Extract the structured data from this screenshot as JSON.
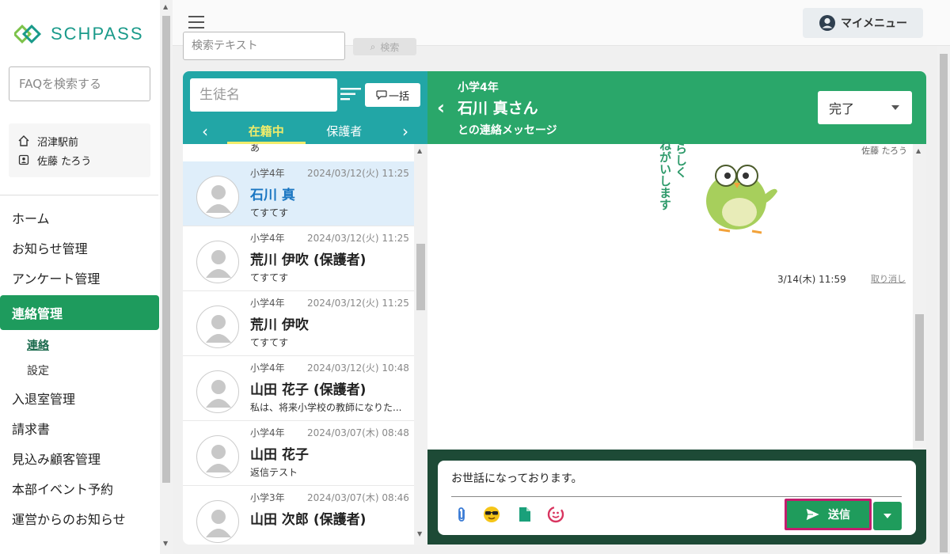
{
  "brand": {
    "name": "SCHPASS",
    "color": "#1a9a8a"
  },
  "sidebar": {
    "faq_placeholder": "FAQを検索する",
    "school": "沼津駅前",
    "user": "佐藤 たろう",
    "nav": [
      {
        "label": "ホーム"
      },
      {
        "label": "お知らせ管理"
      },
      {
        "label": "アンケート管理"
      },
      {
        "label": "連絡管理",
        "active": true
      },
      {
        "label": "連絡",
        "sub": true,
        "selected": true
      },
      {
        "label": "設定",
        "sub": true
      },
      {
        "label": "入退室管理"
      },
      {
        "label": "請求書"
      },
      {
        "label": "見込み顧客管理"
      },
      {
        "label": "本部イベント予約"
      },
      {
        "label": "運営からのお知らせ"
      }
    ]
  },
  "topbar": {
    "mymenu_label": "マイメニュー"
  },
  "search_strip": {
    "placeholder": "検索テキスト",
    "button_label": "検索"
  },
  "list": {
    "student_placeholder": "生徒名",
    "bulk_label": "一括",
    "tabs": [
      "在籍中",
      "保護者"
    ],
    "active_tab": 0,
    "partial_item_text": "あ",
    "items": [
      {
        "grade": "小学4年",
        "date": "2024/03/12(火) 11:25",
        "name": "石川 真",
        "message": "てすてす",
        "selected": true
      },
      {
        "grade": "小学4年",
        "date": "2024/03/12(火) 11:25",
        "name": "荒川 伊吹 (保護者)",
        "message": "てすてす"
      },
      {
        "grade": "小学4年",
        "date": "2024/03/12(火) 11:25",
        "name": "荒川 伊吹",
        "message": "てすてす"
      },
      {
        "grade": "小学4年",
        "date": "2024/03/12(火) 10:48",
        "name": "山田 花子 (保護者)",
        "message": "私は、将来小学校の教師になりた..."
      },
      {
        "grade": "小学4年",
        "date": "2024/03/07(木) 08:48",
        "name": "山田 花子",
        "message": "返信テスト"
      },
      {
        "grade": "小学3年",
        "date": "2024/03/07(木) 08:46",
        "name": "山田 次郎 (保護者)",
        "message": ""
      }
    ]
  },
  "chat": {
    "grade": "小学4年",
    "name": "石川 真さん",
    "subtitle": "との連絡メッセージ",
    "status": "完了",
    "sender": "佐藤 たろう",
    "sticker_text": "よろしくおねがいします",
    "message_time": "3/14(木) 11:59",
    "undo_label": "取り消し",
    "compose_text": "お世話になっております。",
    "send_label": "送信",
    "header_color": "#2aa76a",
    "compose_bg": "#1d4a36"
  }
}
